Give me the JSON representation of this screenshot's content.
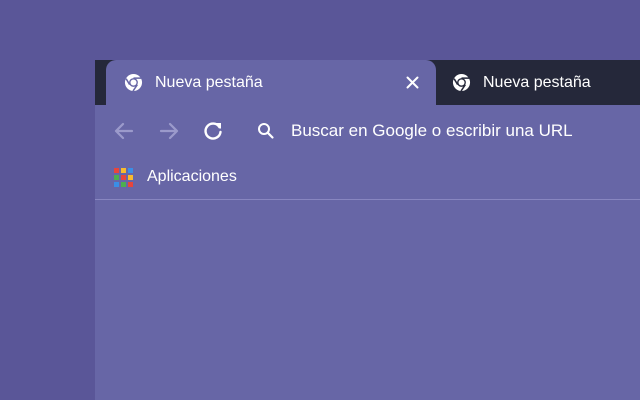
{
  "tabs": [
    {
      "title": "Nueva pestaña",
      "active": true,
      "icon": "chrome-icon"
    },
    {
      "title": "Nueva pestaña",
      "active": false,
      "icon": "chrome-icon"
    }
  ],
  "toolbar": {
    "back_icon": "arrow-left-icon",
    "forward_icon": "arrow-right-icon",
    "reload_icon": "reload-icon"
  },
  "omnibox": {
    "placeholder": "Buscar en Google o escribir una URL",
    "icon": "search-icon"
  },
  "bookmarks": {
    "apps_label": "Aplicaciones",
    "apps_icon": "apps-grid-icon"
  },
  "colors": {
    "desktop_background": "#5a5698",
    "frame_background": "#6766a6",
    "tabstrip_background": "#25283a",
    "text": "#ffffff",
    "disabled_icon": "#9b9acb",
    "apps_grid": [
      "#e8453c",
      "#f9bb2d",
      "#3a8ee6",
      "#4caf50",
      "#e8453c",
      "#f9bb2d",
      "#3a8ee6",
      "#4caf50",
      "#e8453c"
    ]
  }
}
